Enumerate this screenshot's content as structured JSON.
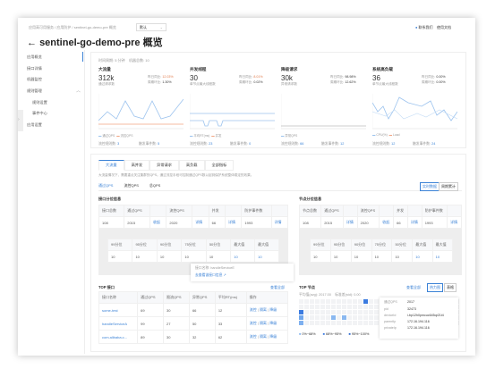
{
  "breadcrumb": [
    "应用高可用服务",
    "应用防护",
    "sentinel-go-demo-pre 概览"
  ],
  "env_select": "默认",
  "title": "sentinel-go-demo-pre 概览",
  "header_links": [
    "联系我们",
    "使用文档"
  ],
  "sidebar": [
    "应用概览",
    "接口详情",
    "机器监控",
    "规则管理",
    "规则设置",
    "事件中心",
    "应用设置"
  ],
  "overview": {
    "period": "时间周期: 5 分钟",
    "machines": "机器总数: 10",
    "metrics": [
      {
        "title": "大流量",
        "value": "312k",
        "sub": "通过请求数",
        "r1": "昨日同比:",
        "v1": "12.03%",
        "r2": "周期环比:",
        "v2": "1.30%",
        "legend": [
          "通过QPS",
          "流控QPS"
        ],
        "f1": "流控规则数:",
        "n1": "3",
        "f2": "触发事件数:",
        "n2": "5"
      },
      {
        "title": "并发线程",
        "value": "30",
        "sub": "单节点最大线程数",
        "r1": "昨日同比:",
        "v1": "8.01%",
        "r2": "周期环比:",
        "v2": "0.02%",
        "legend": [
          "平均RT(ms)",
          "并发"
        ],
        "f1": "流控规则数:",
        "n1": "23",
        "f2": "触发事件数:",
        "n2": "0"
      },
      {
        "title": "降级请求",
        "value": "30k",
        "sub": "异常请求数",
        "r1": "昨日同比:",
        "v1": "98.98%",
        "r2": "周期环比:",
        "v2": "12.62%",
        "legend": [
          "异常QPS"
        ],
        "f1": "流控规则数:",
        "n1": "66",
        "f2": "触发事件数:",
        "n2": "12"
      },
      {
        "title": "系统高负载",
        "value": "36",
        "sub": "单节点最大线程数",
        "r1": "昨日同比:",
        "v1": "0.00%",
        "r2": "周期环比:",
        "v2": "0.00%",
        "legend": [
          "CPU(%)",
          "Load"
        ],
        "f1": "流控规则数:",
        "n1": "12",
        "f2": "触发事件数:",
        "n2": "24"
      }
    ]
  },
  "tabs": [
    "大流量",
    "高并发",
    "异常请求",
    "高负载",
    "全部指标"
  ],
  "tab_desc": "大流量情况下，需要重点关注集群的QPS。通过流控手段可控制通过QPS数以起到保护系统整体稳定的效果。",
  "subtabs": [
    "通过QPS",
    "流控QPS",
    "总QPS"
  ],
  "mode_buttons": [
    "实时数据",
    "周期累计"
  ],
  "iface_section": {
    "title": "接口分位信息",
    "headers": [
      "接口总数",
      "通过QPS",
      "",
      "流控QPS",
      "",
      "并发",
      "",
      "防护事件数",
      ""
    ],
    "row": [
      "108",
      "2015",
      "收起",
      "2020",
      "详情",
      "66",
      "详情",
      "1993",
      "详情"
    ]
  },
  "node_section": {
    "title": "节点分位信息",
    "headers": [
      "节点总数",
      "通过QPS",
      "",
      "流控QPS",
      "",
      "并发",
      "",
      "防护事件数",
      ""
    ],
    "row": [
      "108",
      "2015",
      "详情",
      "2020",
      "收起",
      "66",
      "详情",
      "1993",
      "详情"
    ]
  },
  "pct_headers": [
    "99分位",
    "95分位",
    "90分位",
    "75分位",
    "50分位",
    "最大值",
    "最大值"
  ],
  "pct_row": [
    "10",
    "10",
    "10",
    "10",
    "10",
    "10",
    "10"
  ],
  "iface_tooltip": {
    "name": "接口名称: handleServiceE",
    "link": "去查看该接口信息"
  },
  "top_iface": {
    "title": "TOP 接口",
    "view_all": "查看全部",
    "headers": [
      "接口名称",
      "通过QPS",
      "限流QPS",
      "异常QPS",
      "平均RT(ms)",
      "操作"
    ],
    "rows": [
      [
        "some-test",
        "69",
        "30",
        "66",
        "12"
      ],
      [
        "handleServiceA",
        "99",
        "27",
        "50",
        "33"
      ],
      [
        "com.alibaba.c...",
        "89",
        "30",
        "32",
        "62"
      ]
    ],
    "actions": [
      "流控",
      "隔离",
      "降级"
    ]
  },
  "top_node": {
    "title": "TOP 节点",
    "view_all": "查看全部",
    "views": [
      "热力图",
      "表格"
    ],
    "avg": "平均值(avg): 2017.00",
    "std": "标准差(std): 0.00",
    "legend": [
      "0%~68%",
      "68%~95%",
      "95%~100%"
    ],
    "tooltip": [
      [
        "通过QPS",
        "2017"
      ],
      [
        "pid",
        "32473"
      ],
      [
        "deviceId",
        "i-bp12h0pmcuc645qr21t4"
      ],
      [
        "parentIp",
        "172.16.194.116"
      ],
      [
        "privateIp",
        "172.16.194.116"
      ]
    ]
  }
}
